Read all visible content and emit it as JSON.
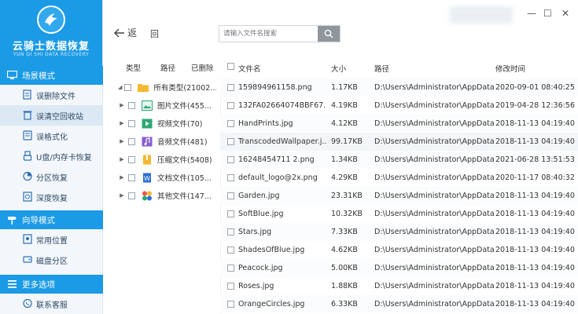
{
  "app": {
    "title": "云骑士数据恢复",
    "subtitle": "YUN QI SHI DATA RECOVERY"
  },
  "sidebar": {
    "sections": [
      {
        "title": "场景模式",
        "items": [
          {
            "label": "误删除文件",
            "icon": "file-delete-icon"
          },
          {
            "label": "误清空回收站",
            "icon": "recycle-bin-icon"
          },
          {
            "label": "误格式化",
            "icon": "format-icon"
          },
          {
            "label": "U盘/内存卡恢复",
            "icon": "usb-icon"
          },
          {
            "label": "分区恢复",
            "icon": "partition-icon"
          },
          {
            "label": "深度恢复",
            "icon": "deep-scan-icon"
          }
        ]
      },
      {
        "title": "向导模式",
        "items": [
          {
            "label": "常用位置",
            "icon": "location-icon"
          },
          {
            "label": "磁盘分区",
            "icon": "disk-icon"
          }
        ]
      },
      {
        "title": "更多选项",
        "items": [
          {
            "label": "联系客服",
            "icon": "support-icon"
          }
        ]
      }
    ],
    "active_item": "误清空回收站"
  },
  "toolbar": {
    "back_label": "返",
    "refresh_label": "回",
    "search_placeholder": "请输入文件名搜索"
  },
  "window_controls": {
    "minimize": "—",
    "maximize": "☐",
    "close": "✕"
  },
  "tree": {
    "headers": [
      "类型",
      "路径",
      "已删除"
    ],
    "rows": [
      {
        "label": "所有类型(21002...",
        "icon": "folder-icon",
        "color": "#f5b82e",
        "expanded": true
      },
      {
        "label": "图片文件(455...",
        "icon": "image-icon",
        "color": "#2aa876"
      },
      {
        "label": "视频文件(70)",
        "icon": "video-icon",
        "color": "#2aa876"
      },
      {
        "label": "音频文件(481)",
        "icon": "audio-icon",
        "color": "#8a5cd6"
      },
      {
        "label": "压缩文件(5408)",
        "icon": "archive-icon",
        "color": "#f5b82e"
      },
      {
        "label": "文档文件(105...",
        "icon": "document-icon",
        "color": "#2b6fd6"
      },
      {
        "label": "其他文件(147...",
        "icon": "other-files-icon",
        "color": "#e8584a"
      }
    ]
  },
  "table": {
    "headers": {
      "name": "文件名",
      "size": "大小",
      "path": "路径",
      "time": "修改时间"
    },
    "rows": [
      {
        "name": "159894961158.png",
        "size": "1.17KB",
        "path": "D:\\Users\\Administrator\\AppData...",
        "time": "2020-09-01 08:40:25"
      },
      {
        "name": "132FA02664074BBF67...",
        "size": "4.19KB",
        "path": "D:\\Users\\Administrator\\AppData...",
        "time": "2019-04-28 12:36:56"
      },
      {
        "name": "HandPrints.jpg",
        "size": "4.12KB",
        "path": "D:\\Users\\Administrator\\AppData...",
        "time": "2018-11-13 04:19:40"
      },
      {
        "name": "TranscodedWallpaper.j...",
        "size": "99.17KB",
        "path": "D:\\Users\\Administrator\\AppData...",
        "time": "2018-11-13 04:19:40"
      },
      {
        "name": "16248454711 2.png",
        "size": "1.34KB",
        "path": "D:\\Users\\Administrator\\AppData...",
        "time": "2021-06-28 13:51:53"
      },
      {
        "name": "default_logo@2x.png",
        "size": "4.29KB",
        "path": "D:\\Users\\Administrator\\AppData...",
        "time": "2020-11-17 08:40:32"
      },
      {
        "name": "Garden.jpg",
        "size": "23.31KB",
        "path": "D:\\Users\\Administrator\\AppData...",
        "time": "2018-11-13 04:19:40"
      },
      {
        "name": "SoftBlue.jpg",
        "size": "10.32KB",
        "path": "D:\\Users\\Administrator\\AppData...",
        "time": "2018-11-13 04:19:40"
      },
      {
        "name": "Stars.jpg",
        "size": "7.33KB",
        "path": "D:\\Users\\Administrator\\AppData...",
        "time": "2018-11-13 04:19:40"
      },
      {
        "name": "ShadesOfBlue.jpg",
        "size": "4.62KB",
        "path": "D:\\Users\\Administrator\\AppData...",
        "time": "2018-11-13 04:19:40"
      },
      {
        "name": "Peacock.jpg",
        "size": "5.00KB",
        "path": "D:\\Users\\Administrator\\AppData...",
        "time": "2018-11-13 04:19:40"
      },
      {
        "name": "Roses.jpg",
        "size": "1.88KB",
        "path": "D:\\Users\\Administrator\\AppData...",
        "time": "2018-11-13 04:19:40"
      },
      {
        "name": "OrangeCircles.jpg",
        "size": "6.33KB",
        "path": "D:\\Users\\Administrator\\AppData...",
        "time": "2018-11-13 04:19:40"
      }
    ]
  },
  "colors": {
    "brand": "#1b9ae6",
    "active_item_bg": "#dce9f5"
  }
}
